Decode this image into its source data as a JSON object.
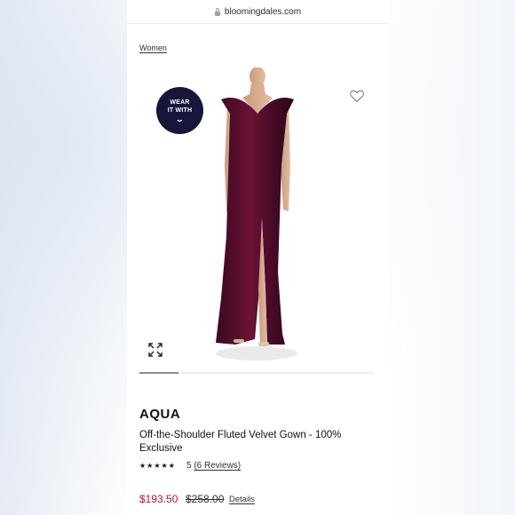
{
  "browser": {
    "url": "bloomingdales.com"
  },
  "breadcrumb": {
    "label": "Women"
  },
  "wear_it_with": {
    "line1": "WEAR",
    "line2": "IT WITH"
  },
  "product": {
    "brand": "AQUA",
    "name": "Off-the-Shoulder Fluted Velvet Gown - 100% Exclusive",
    "stars": "★★★★★",
    "rating": "5",
    "reviews_label": "(6 Reviews)",
    "sale_price": "$193.50",
    "original_price": "$258.00",
    "details_label": "Details"
  },
  "carousel": {
    "current_index": 1,
    "progress": 0.17
  },
  "icons": {
    "lock": "lock-icon",
    "heart": "heart-icon",
    "expand": "expand-icon",
    "chevron": "chevron-down-icon"
  },
  "colors": {
    "accent_navy": "#15163a",
    "sale_red": "#b0143a",
    "dress_burgundy": "#5a0f2e"
  }
}
